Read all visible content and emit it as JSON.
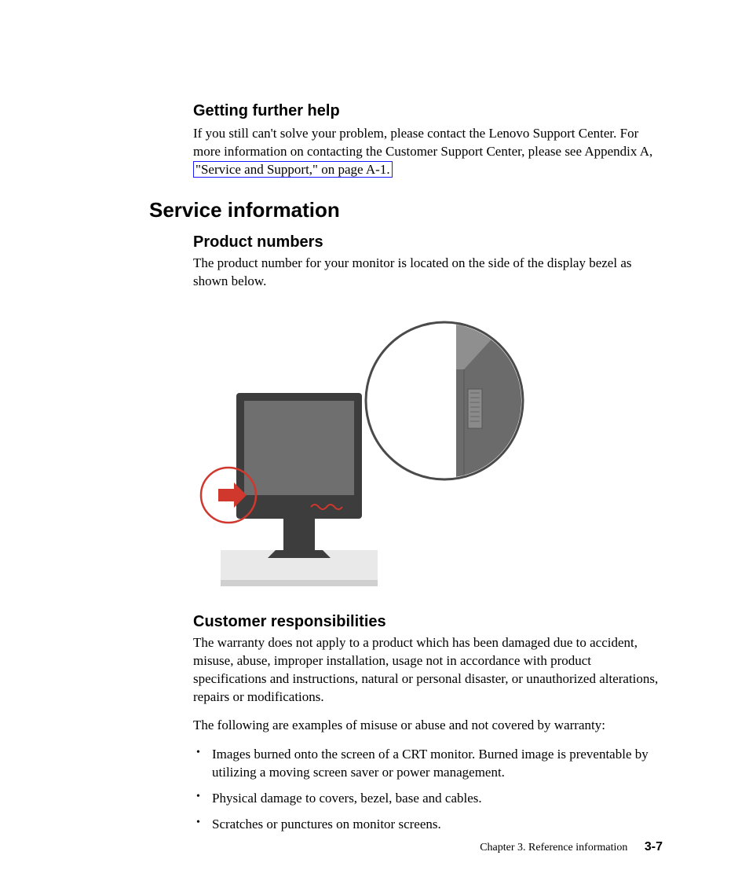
{
  "section_getting": {
    "heading": "Getting further help",
    "body_prefix": "If you still can't solve your problem, please contact the Lenovo Support Center. For more information on contacting the Customer Support Center, please see Appendix A, ",
    "link_text": "\"Service and Support,\" on page A-1."
  },
  "service": {
    "heading": "Service information"
  },
  "product_numbers": {
    "heading": "Product numbers",
    "body": "The product number for your monitor is located on the side of the display bezel as shown below."
  },
  "customer": {
    "heading": "Customer responsibilities",
    "body1": "The warranty does not apply to a product which has been damaged due to accident, misuse, abuse, improper installation, usage not in accordance with product specifications and instructions, natural or personal disaster, or unauthorized alterations, repairs or modifications.",
    "body2": "The following are examples of misuse or abuse and not covered by warranty:",
    "bullets": [
      "Images burned onto the screen of a CRT monitor. Burned image is preventable by utilizing a moving screen saver or power management.",
      "Physical damage to covers, bezel, base and cables.",
      "Scratches or punctures on monitor screens."
    ]
  },
  "footer": {
    "chapter": "Chapter 3. Reference information",
    "page": "3-7"
  }
}
